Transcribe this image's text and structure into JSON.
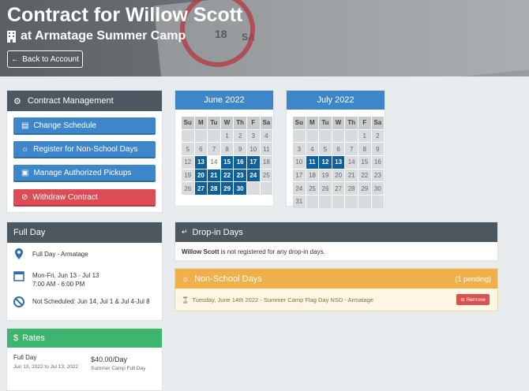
{
  "header": {
    "title": "Contract for Willow Scott",
    "subtitle": "at Armatage Summer Camp",
    "back_label": "Back to Account",
    "bg_numbers": [
      "18",
      "SA"
    ]
  },
  "contract_management": {
    "title": "Contract Management",
    "buttons": [
      "Change Schedule",
      "Register for Non-School Days",
      "Manage Authorized Pickups",
      "Withdraw Contract"
    ]
  },
  "calendars": [
    {
      "month": "June 2022",
      "days": [
        "Su",
        "M",
        "Tu",
        "W",
        "Th",
        "F",
        "Sa"
      ],
      "cells": [
        "",
        "",
        "",
        "1",
        "2",
        "3",
        "4",
        "5",
        "6",
        "7",
        "8",
        "9",
        "10",
        "11",
        "12",
        "13",
        "14",
        "15",
        "16",
        "17",
        "18",
        "19",
        "20",
        "21",
        "22",
        "23",
        "24",
        "25",
        "26",
        "27",
        "28",
        "29",
        "30",
        "",
        ""
      ],
      "scheduled": [
        "13",
        "15",
        "16",
        "17",
        "20",
        "21",
        "22",
        "23",
        "24",
        "27",
        "28",
        "29",
        "30"
      ]
    },
    {
      "month": "July 2022",
      "days": [
        "Su",
        "M",
        "Tu",
        "W",
        "Th",
        "F",
        "Sa"
      ],
      "cells": [
        "",
        "",
        "",
        "",
        "",
        "1",
        "2",
        "3",
        "4",
        "5",
        "6",
        "7",
        "8",
        "9",
        "10",
        "11",
        "12",
        "13",
        "14",
        "15",
        "16",
        "17",
        "18",
        "19",
        "20",
        "21",
        "22",
        "23",
        "24",
        "25",
        "26",
        "27",
        "28",
        "29",
        "30",
        "31",
        "",
        "",
        "",
        "",
        "",
        ""
      ],
      "scheduled": [
        "11",
        "12",
        "13"
      ]
    }
  ],
  "full_day": {
    "title": "Full Day",
    "location_label": "Full Day",
    "location": "- Armatage",
    "schedule_line1": "Mon-Fri, Jun 13 - Jul 13",
    "schedule_line2": "7:00 AM - 6:00 PM",
    "not_scheduled_label": "Not Scheduled:",
    "not_scheduled_value": "Jun 14, Jul 1 & Jul 4-Jul 8"
  },
  "rates": {
    "title": "Rates",
    "name": "Full Day",
    "dates": "Jun 13, 2022 to Jul 13, 2022",
    "price": "$40.00/Day",
    "price_note": "Summer Camp Full Day"
  },
  "drop_in": {
    "title": "Drop-in Days",
    "name": "Willow Scott",
    "message": "is not registered for any drop-in days."
  },
  "non_school": {
    "title": "Non-School Days",
    "pending": "(1 pending)",
    "item": "Tuesday, June 14th 2022 - Summer Camp Flag Day NSD - Armatage",
    "remove_label": "Remove"
  },
  "colors": {
    "blue": "#3d86c9",
    "red": "#db4c55",
    "green": "#3eb56f",
    "orange": "#efb04b",
    "dark": "#4d5760",
    "scheduled": "#0f5f9c"
  }
}
